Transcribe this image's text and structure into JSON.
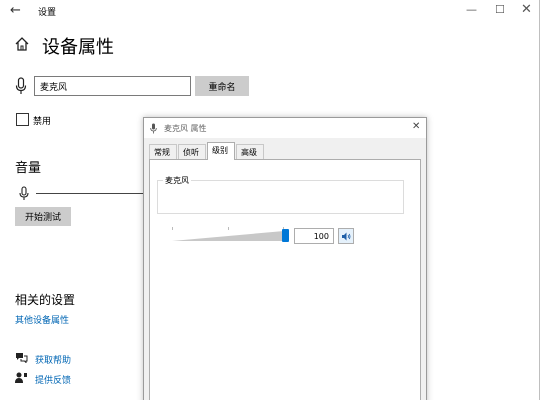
{
  "window": {
    "back_glyph": "←",
    "title": "设置",
    "minimize_glyph": "—",
    "maximize_glyph": "☐",
    "close_glyph": "✕"
  },
  "page": {
    "title": "设备属性"
  },
  "device": {
    "name_value": "麦克风",
    "rename_label": "重命名",
    "disable_label": "禁用"
  },
  "volume": {
    "heading": "音量",
    "level_fraction": 0.0,
    "start_test_label": "开始测试"
  },
  "related": {
    "heading": "相关的设置",
    "other_props_link": "其他设备属性"
  },
  "help": {
    "get_help": "获取帮助",
    "feedback": "提供反馈"
  },
  "dialog": {
    "title": "麦克风 属性",
    "close_glyph": "✕",
    "tabs": [
      {
        "label": "常规"
      },
      {
        "label": "侦听"
      },
      {
        "label": "级别"
      },
      {
        "label": "高级"
      }
    ],
    "active_tab": "级别",
    "level_group_label": "麦克风",
    "level_value": "100",
    "slider_fraction": 1.0
  },
  "colors": {
    "accent": "#0078d7",
    "link": "#0066b4",
    "button_bg": "#cccccc"
  },
  "icons": {
    "home": "home-icon",
    "microphone": "microphone-icon",
    "help": "help-chat-icon",
    "feedback": "feedback-person-icon",
    "speaker": "speaker-icon"
  }
}
